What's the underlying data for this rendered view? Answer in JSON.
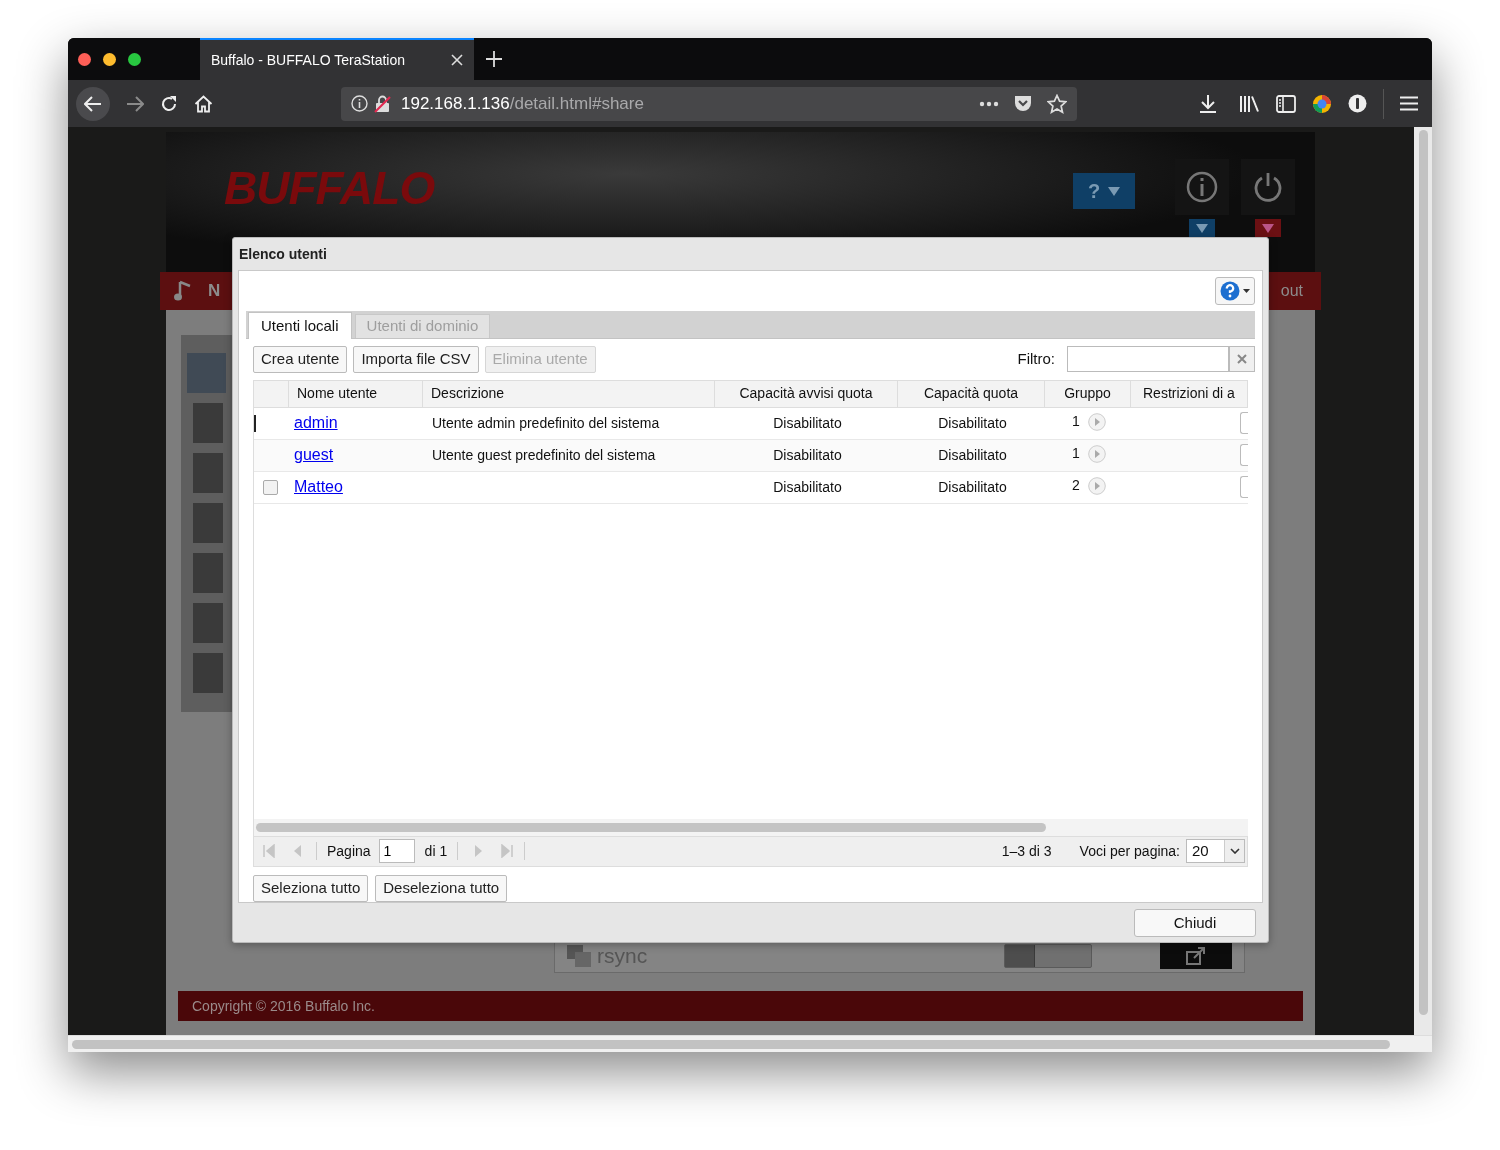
{
  "browser": {
    "tab_title": "Buffalo - BUFFALO TeraStation",
    "url_host": "192.168.1.136",
    "url_path": "/detail.html#share"
  },
  "background_page": {
    "logo": "BUFFALO",
    "help_label": "?",
    "nav_left": "N",
    "nav_right": "out",
    "service": "rsync",
    "service_on": false,
    "footer": "Copyright © 2016 Buffalo Inc."
  },
  "dialog": {
    "title": "Elenco utenti",
    "tabs": [
      {
        "label": "Utenti locali",
        "selected": true,
        "disabled": false
      },
      {
        "label": "Utenti di dominio",
        "selected": false,
        "disabled": true
      }
    ],
    "actions": [
      {
        "label": "Crea utente",
        "disabled": false
      },
      {
        "label": "Importa file CSV",
        "disabled": false
      },
      {
        "label": "Elimina utente",
        "disabled": true
      }
    ],
    "filter_label": "Filtro:",
    "columns": [
      "Nome utente",
      "Descrizione",
      "Capacità avvisi quota",
      "Capacità quota",
      "Gruppo",
      "Restrizioni di a"
    ],
    "rows": [
      {
        "name": "admin",
        "description": "Utente admin predefinito del sistema",
        "quota_alert": "Disabilitato",
        "quota": "Disabilitato",
        "group": "1",
        "focused": true,
        "selectable": false,
        "checked": false
      },
      {
        "name": "guest",
        "description": "Utente guest predefinito del sistema",
        "quota_alert": "Disabilitato",
        "quota": "Disabilitato",
        "group": "1",
        "focused": false,
        "selectable": false,
        "checked": false
      },
      {
        "name": "Matteo",
        "quota_alert": "Disabilitato",
        "quota": "Disabilitato",
        "group": "2",
        "focused": false,
        "selectable": true,
        "checked": false
      }
    ],
    "pager": {
      "page_label": "Pagina",
      "page": "1",
      "page_total": "di 1",
      "range": "1–3 di 3",
      "per_page_label": "Voci per pagina:",
      "per_page": "20"
    },
    "selection_buttons": [
      "Seleziona tutto",
      "Deseleziona tutto"
    ],
    "close_button": "Chiudi"
  }
}
